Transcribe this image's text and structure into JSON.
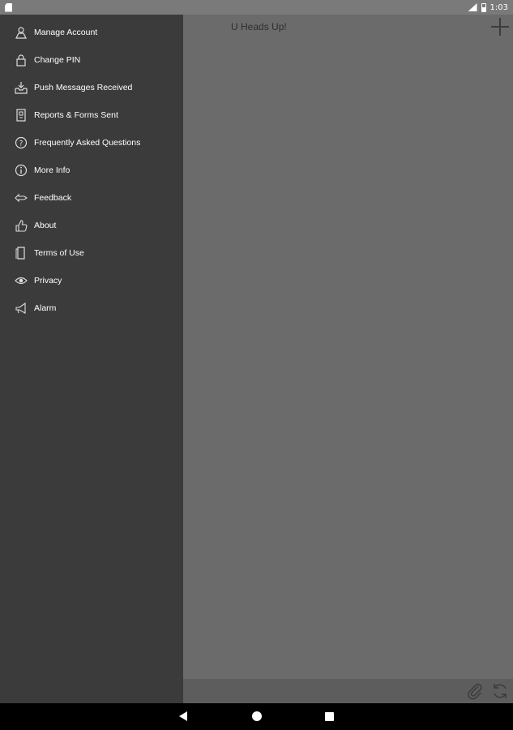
{
  "status_bar": {
    "time": "1:03"
  },
  "app": {
    "title": "U Heads Up!"
  },
  "drawer": {
    "items": [
      {
        "label": "Manage Account",
        "icon": "person-icon"
      },
      {
        "label": "Change PIN",
        "icon": "lock-icon"
      },
      {
        "label": "Push Messages Received",
        "icon": "inbox-icon"
      },
      {
        "label": "Reports & Forms Sent",
        "icon": "document-icon"
      },
      {
        "label": "Frequently Asked Questions",
        "icon": "question-icon"
      },
      {
        "label": "More Info",
        "icon": "info-icon"
      },
      {
        "label": "Feedback",
        "icon": "feedback-icon"
      },
      {
        "label": "About",
        "icon": "thumbs-up-icon"
      },
      {
        "label": "Terms of Use",
        "icon": "page-icon"
      },
      {
        "label": "Privacy",
        "icon": "eye-icon"
      },
      {
        "label": "Alarm",
        "icon": "megaphone-icon"
      }
    ]
  },
  "colors": {
    "drawer_bg": "#3b3b3b",
    "main_bg": "#6b6b6b",
    "status_bar_bg": "#7a7a7a",
    "nav_bar_bg": "#000000"
  }
}
